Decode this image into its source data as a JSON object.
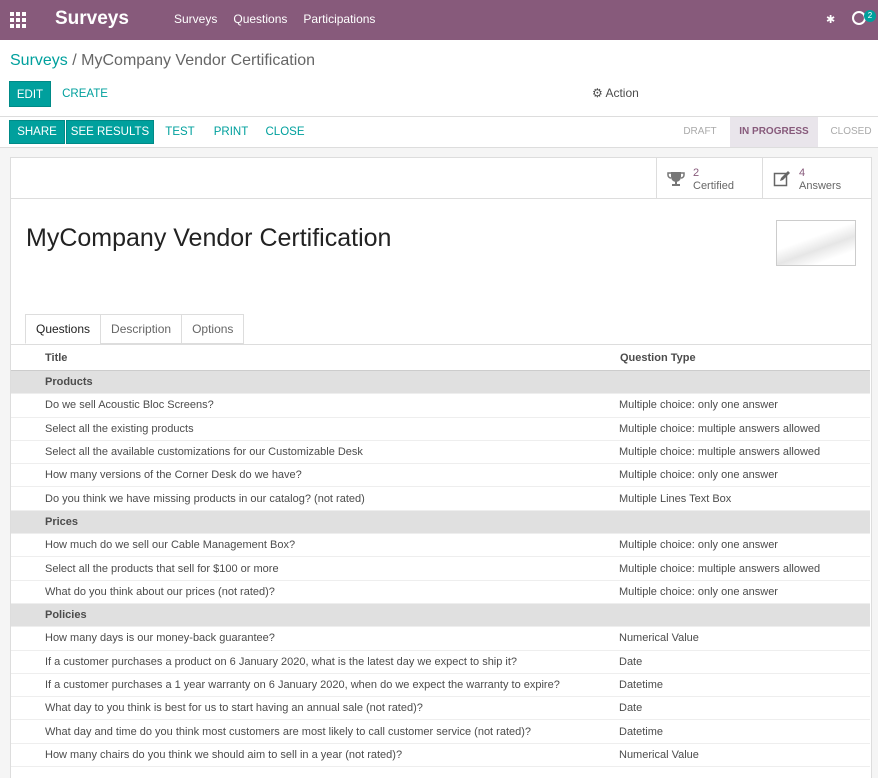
{
  "topbar": {
    "brand": "Surveys",
    "menu": [
      "Surveys",
      "Questions",
      "Participations"
    ],
    "activity_badge": "2"
  },
  "breadcrumb": {
    "parent": "Surveys",
    "separator": "/",
    "current": "MyCompany Vendor Certification"
  },
  "buttons": {
    "edit": "EDIT",
    "create": "CREATE",
    "action": "Action",
    "share": "SHARE",
    "see_results": "SEE RESULTS",
    "test": "TEST",
    "print": "PRINT",
    "close": "CLOSE"
  },
  "stages": [
    "DRAFT",
    "IN PROGRESS",
    "CLOSED"
  ],
  "active_stage": "IN PROGRESS",
  "stats": {
    "certified": {
      "value": "2",
      "label": "Certified"
    },
    "answers": {
      "value": "4",
      "label": "Answers"
    }
  },
  "survey_title": "MyCompany Vendor Certification",
  "tabs": [
    "Questions",
    "Description",
    "Options"
  ],
  "table": {
    "headers": [
      "Title",
      "Question Type"
    ],
    "rows": [
      {
        "section": "Products"
      },
      {
        "title": "Do we sell Acoustic Bloc Screens?",
        "type": "Multiple choice: only one answer"
      },
      {
        "title": "Select all the existing products",
        "type": "Multiple choice: multiple answers allowed"
      },
      {
        "title": "Select all the available customizations for our Customizable Desk",
        "type": "Multiple choice: multiple answers allowed"
      },
      {
        "title": "How many versions of the Corner Desk do we have?",
        "type": "Multiple choice: only one answer"
      },
      {
        "title": "Do you think we have missing products in our catalog? (not rated)",
        "type": "Multiple Lines Text Box"
      },
      {
        "section": "Prices"
      },
      {
        "title": "How much do we sell our Cable Management Box?",
        "type": "Multiple choice: only one answer"
      },
      {
        "title": "Select all the products that sell for $100 or more",
        "type": "Multiple choice: multiple answers allowed"
      },
      {
        "title": "What do you think about our prices (not rated)?",
        "type": "Multiple choice: only one answer"
      },
      {
        "section": "Policies"
      },
      {
        "title": "How many days is our money-back guarantee?",
        "type": "Numerical Value"
      },
      {
        "title": "If a customer purchases a product on 6 January 2020, what is the latest day we expect to ship it?",
        "type": "Date"
      },
      {
        "title": "If a customer purchases a 1 year warranty on 6 January 2020, when do we expect the warranty to expire?",
        "type": "Datetime"
      },
      {
        "title": "What day to you think is best for us to start having an annual sale (not rated)?",
        "type": "Date"
      },
      {
        "title": "What day and time do you think most customers are most likely to call customer service (not rated)?",
        "type": "Datetime"
      },
      {
        "title": "How many chairs do you think we should aim to sell in a year (not rated)?",
        "type": "Numerical Value"
      }
    ]
  },
  "colors": {
    "brand": "#875a7b",
    "accent": "#00a09d"
  }
}
